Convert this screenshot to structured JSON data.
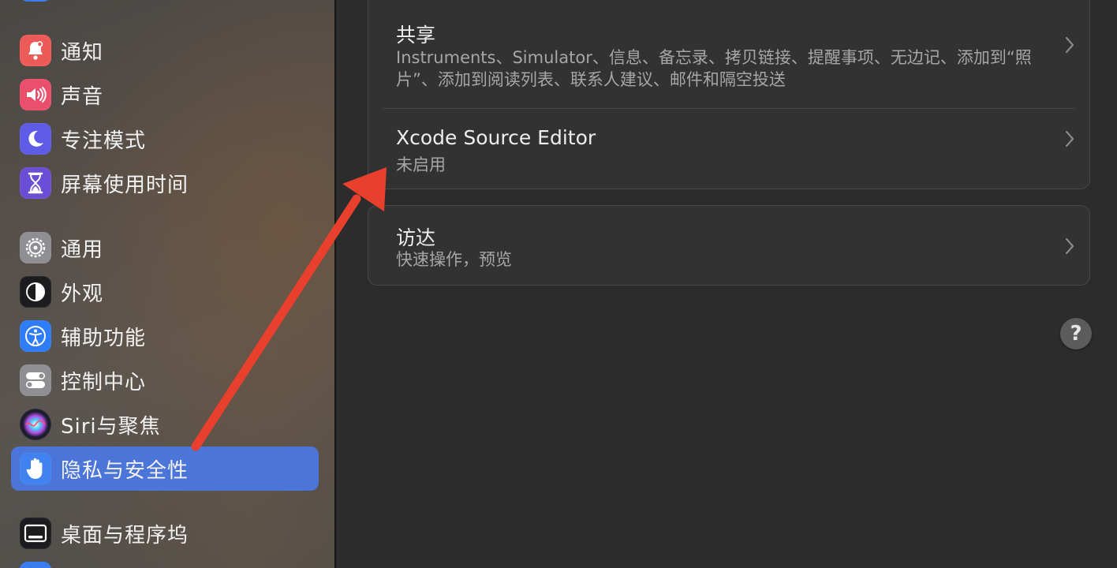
{
  "sidebar": {
    "items": [
      {
        "label": "通知",
        "icon": "bell-icon",
        "color": "#ec5b58"
      },
      {
        "label": "声音",
        "icon": "speaker-icon",
        "color": "#ea4f6b"
      },
      {
        "label": "专注模式",
        "icon": "moon-icon",
        "color": "#5e5ce6"
      },
      {
        "label": "屏幕使用时间",
        "icon": "hourglass-icon",
        "color": "#6a4fd6"
      },
      {
        "label": "通用",
        "icon": "gear-icon",
        "color": "#8e8e93"
      },
      {
        "label": "外观",
        "icon": "appearance-icon",
        "color": "#1c1c1e"
      },
      {
        "label": "辅助功能",
        "icon": "accessibility-icon",
        "color": "#2e7cf6"
      },
      {
        "label": "控制中心",
        "icon": "toggles-icon",
        "color": "#8e8e93"
      },
      {
        "label": "Siri与聚焦",
        "icon": "siri-icon",
        "color": "#1d1d2e"
      },
      {
        "label": "隐私与安全性",
        "icon": "hand-icon",
        "color": "#3f82f0",
        "selected": true
      },
      {
        "label": "桌面与程序坞",
        "icon": "dock-icon",
        "color": "#1c1c1e"
      }
    ]
  },
  "main": {
    "group1": {
      "rows": [
        {
          "title": "共享",
          "subtitle": "Instruments、Simulator、信息、备忘录、拷贝链接、提醒事项、无边记、添加到“照片”、添加到阅读列表、联系人建议、邮件和隔空投送"
        },
        {
          "title": "Xcode Source Editor",
          "subtitle": "未启用"
        }
      ]
    },
    "group2": {
      "rows": [
        {
          "title": "访达",
          "subtitle": "快速操作，预览"
        }
      ]
    },
    "help_label": "?"
  },
  "annotation": {
    "arrow_color": "#e8402d"
  }
}
